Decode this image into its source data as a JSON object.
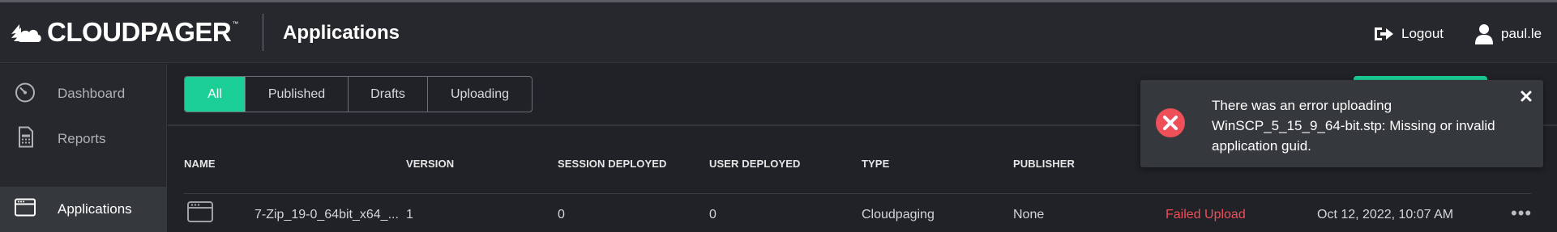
{
  "brand": {
    "name": "CLOUDPAGER",
    "trademark": "™"
  },
  "header": {
    "title": "Applications",
    "logout_label": "Logout",
    "username": "paul.le"
  },
  "sidebar": {
    "items": [
      {
        "label": "Dashboard",
        "icon": "gauge-icon",
        "active": false
      },
      {
        "label": "Reports",
        "icon": "calculator-document-icon",
        "active": false
      },
      {
        "label": "Applications",
        "icon": "browser-window-icon",
        "active": true
      }
    ]
  },
  "tabs": [
    {
      "label": "All",
      "active": true
    },
    {
      "label": "Published",
      "active": false
    },
    {
      "label": "Drafts",
      "active": false
    },
    {
      "label": "Uploading",
      "active": false
    }
  ],
  "table": {
    "columns": [
      "NAME",
      "VERSION",
      "SESSION DEPLOYED",
      "USER DEPLOYED",
      "TYPE",
      "PUBLISHER"
    ],
    "rows": [
      {
        "name": "7-Zip_19-0_64bit_x64_...",
        "version": "1",
        "session_deployed": "0",
        "user_deployed": "0",
        "type": "Cloudpaging",
        "publisher": "None",
        "status": "Failed Upload",
        "date": "Oct 12, 2022, 10:07 AM",
        "actions_label": "•••"
      }
    ]
  },
  "toast": {
    "message": "There was an error uploading WinSCP_5_15_9_64-bit.stp: Missing or invalid application guid.",
    "close_symbol": "✕"
  },
  "colors": {
    "accent": "#1ccf96",
    "error": "#ef4f58",
    "background": "#202227",
    "panel": "#26282d"
  }
}
